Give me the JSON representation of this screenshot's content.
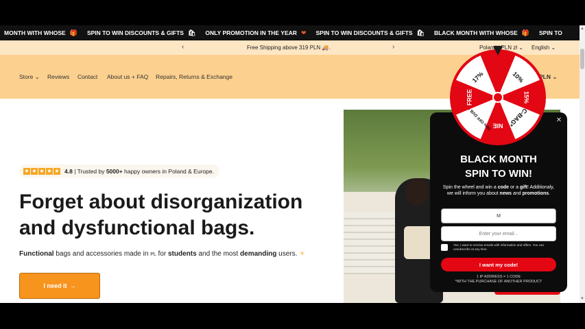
{
  "ticker": {
    "items": [
      {
        "text": "MONTH WITH WHOSE",
        "icon": "🎁"
      },
      {
        "text": "SPIN TO WIN DISCOUNTS & GIFTS",
        "icon": "🛍"
      },
      {
        "text": "ONLY PROMOTION IN THE YEAR",
        "icon": "❤"
      },
      {
        "text": "SPIN TO WIN DISCOUNTS & GIFTS",
        "icon": "🛍"
      },
      {
        "text": "BLACK MONTH WITH WHOSE",
        "icon": "🎁"
      },
      {
        "text": "SPIN TO",
        "icon": ""
      }
    ]
  },
  "shipbar": {
    "prev": "‹",
    "next": "›",
    "message": "Free Shipping above 319 PLN 🚚.",
    "location": "Poland | PLN zł",
    "language": "English",
    "chevron": "⌄"
  },
  "nav": {
    "store": "Store ⌄",
    "reviews": "Reviews",
    "contact": "Contact",
    "about": "About us + FAQ",
    "repairs": "Repairs, Returns & Exchange",
    "currency_fragment": "PLN ⌄"
  },
  "hero": {
    "rating": "4.8",
    "trust_a": " | Trusted by ",
    "trust_bold": "5000+",
    "trust_b": " happy owners in Poland & Europe.",
    "headline_1": "Forget about disorganization",
    "headline_2": "and dysfunctional bags.",
    "sub_1": "Functional",
    "sub_2": " bags and accessories made in ",
    "sub_pl": "PL",
    "sub_3": " for ",
    "sub_4": "students",
    "sub_5": " and the most ",
    "sub_6": "demanding",
    "sub_7": " users. ",
    "sub_icon": "☀",
    "cta": "I need it",
    "cta_arrow": "→"
  },
  "wheel": {
    "segments": [
      "10%",
      "15%",
      "C-BAG*",
      "NIE",
      "50% OFF DVB ON",
      "FREE",
      "17%"
    ],
    "colors": {
      "red": "#e30613",
      "white": "#ffffff",
      "center": "#e30613"
    }
  },
  "popup": {
    "close": "✕",
    "title_1": "BLACK MONTH",
    "title_2": "SPIN TO WIN!",
    "desc_1": "Spin the wheel and win a ",
    "desc_code": "code",
    "desc_2": " or a ",
    "desc_gift": "gift",
    "desc_3": "! Additionaly, we will inform you about ",
    "desc_news": "news",
    "desc_4": " and ",
    "desc_promos": "promotions",
    "desc_5": ".",
    "name_value": "M",
    "email_placeholder": "Enter your email...",
    "consent": "Yes, I want to receive emails with information and offers. You can unsubscribe at any time.",
    "button": "I want my code!",
    "foot_1": "1 IP ADDRESS = 1 CODE",
    "foot_2": "*WITH THE PURCHASE OF ANOTHER PRODUCT"
  },
  "colors": {
    "accent_orange": "#f7941d",
    "nav_bg": "#fcd08e",
    "ship_bg": "#fde6c4",
    "popup_red": "#e30613"
  }
}
